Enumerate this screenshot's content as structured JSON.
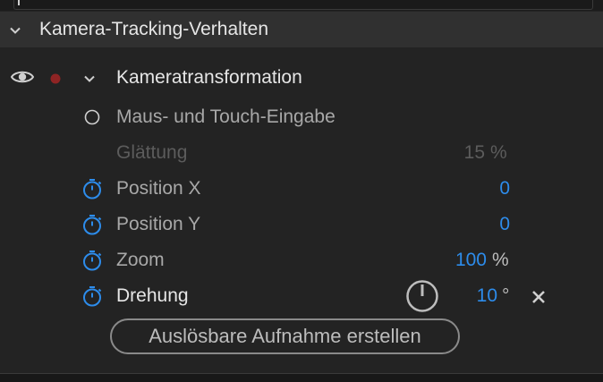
{
  "section": {
    "title": "Kamera-Tracking-Verhalten",
    "expanded": true
  },
  "group": {
    "title": "Kameratransformation",
    "expanded": true
  },
  "rows": {
    "mouse_touch": {
      "label": "Maus- und Touch-Eingabe",
      "selected": false
    },
    "smoothing": {
      "label": "Glättung",
      "value": "15",
      "unit": "%"
    },
    "position_x": {
      "label": "Position X",
      "value": "0"
    },
    "position_y": {
      "label": "Position Y",
      "value": "0"
    },
    "zoom": {
      "label": "Zoom",
      "value": "100",
      "unit": "%"
    },
    "rotation": {
      "label": "Drehung",
      "value": "10",
      "unit": "°"
    }
  },
  "trigger_button": {
    "label": "Auslösbare Aufnahme erstellen"
  },
  "colors": {
    "accent_blue": "#2d8ceb",
    "record_dot": "#8f2424",
    "background": "#232323",
    "header": "#303030"
  },
  "icons": {
    "visibility": "eye-icon",
    "record": "record-dot-icon",
    "collapse": "chevron-down-icon",
    "radio": "radio-button-icon",
    "stopwatch": "stopwatch-icon",
    "dial": "rotation-dial-icon",
    "remove": "close-icon"
  }
}
